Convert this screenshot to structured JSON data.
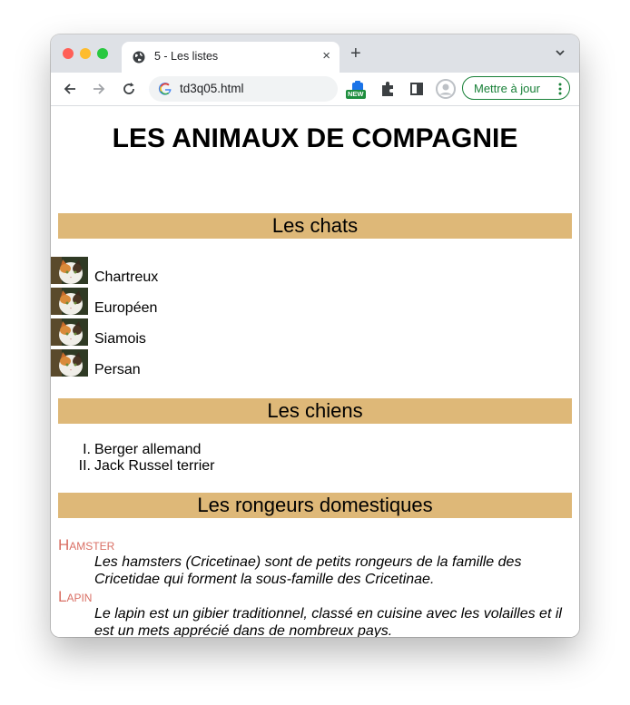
{
  "browser": {
    "tab_title": "5 - Les listes",
    "tab_close": "×",
    "new_tab": "+",
    "url": "td3q05.html",
    "new_badge": "NEW",
    "update_button": "Mettre à jour",
    "icons": [
      "globe-icon",
      "back-icon",
      "forward-icon",
      "reload-icon",
      "google-icon",
      "extension-new-icon",
      "puzzle-icon",
      "sidepanel-icon",
      "avatar-icon",
      "kebab-icon",
      "tab-search-icon"
    ]
  },
  "page": {
    "title": "LES ANIMAUX DE COMPAGNIE",
    "cats": {
      "heading": "Les chats",
      "items": [
        "Chartreux",
        "Européen",
        "Siamois",
        "Persan"
      ]
    },
    "dogs": {
      "heading": "Les chiens",
      "markers": [
        "I.",
        "II."
      ],
      "items": [
        "Berger allemand",
        "Jack Russel terrier"
      ]
    },
    "rodents": {
      "heading": "Les rongeurs domestiques",
      "terms": [
        {
          "term": "Hamster",
          "definition": "Les hamsters (Cricetinae) sont de petits rongeurs de la famille des Cricetidae qui forment la sous-famille des Cricetinae."
        },
        {
          "term": "Lapin",
          "definition": "Le lapin est un gibier traditionnel, classé en cuisine avec les volailles et il est un mets apprécié dans de nombreux pays."
        }
      ]
    }
  },
  "colors": {
    "section_band": "#deb878",
    "term": "#d96f64",
    "update_green": "#188038"
  }
}
